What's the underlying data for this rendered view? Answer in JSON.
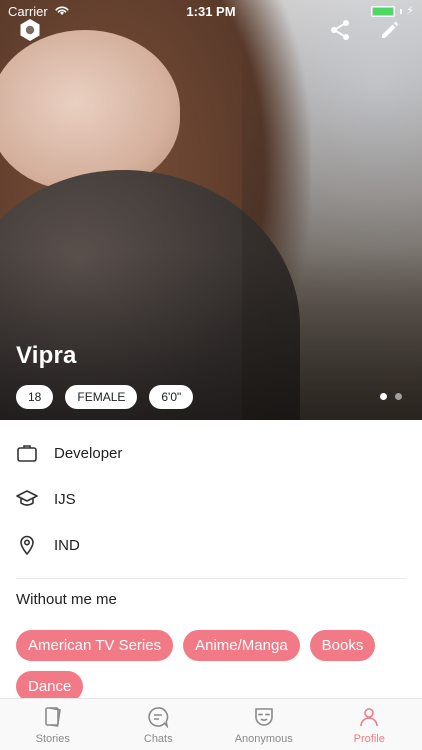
{
  "status_bar": {
    "carrier": "Carrier",
    "time": "1:31 PM",
    "battery_level": 1.0
  },
  "profile": {
    "name": "Vipra",
    "badges": [
      "18",
      "FEMALE",
      "6'0\""
    ],
    "photo_index": 1,
    "photo_count": 2,
    "details": [
      {
        "icon": "briefcase-icon",
        "text": "Developer"
      },
      {
        "icon": "graduation-cap-icon",
        "text": "IJS"
      },
      {
        "icon": "location-pin-icon",
        "text": "IND"
      }
    ],
    "about": "Without me me",
    "interests": [
      "American TV Series",
      "Anime/Manga",
      "Books",
      "Dance"
    ]
  },
  "top_actions": {
    "left_icon": "hexagon-icon",
    "right_icons": [
      "share-icon",
      "edit-icon"
    ]
  },
  "tabs": [
    {
      "label": "Stories",
      "icon": "stories-icon",
      "active": false
    },
    {
      "label": "Chats",
      "icon": "chats-icon",
      "active": false
    },
    {
      "label": "Anonymous",
      "icon": "mask-icon",
      "active": false
    },
    {
      "label": "Profile",
      "icon": "profile-icon",
      "active": true
    }
  ],
  "colors": {
    "accent": "#f27a86",
    "tab_inactive": "#8a8a8a",
    "battery": "#4cd964"
  }
}
